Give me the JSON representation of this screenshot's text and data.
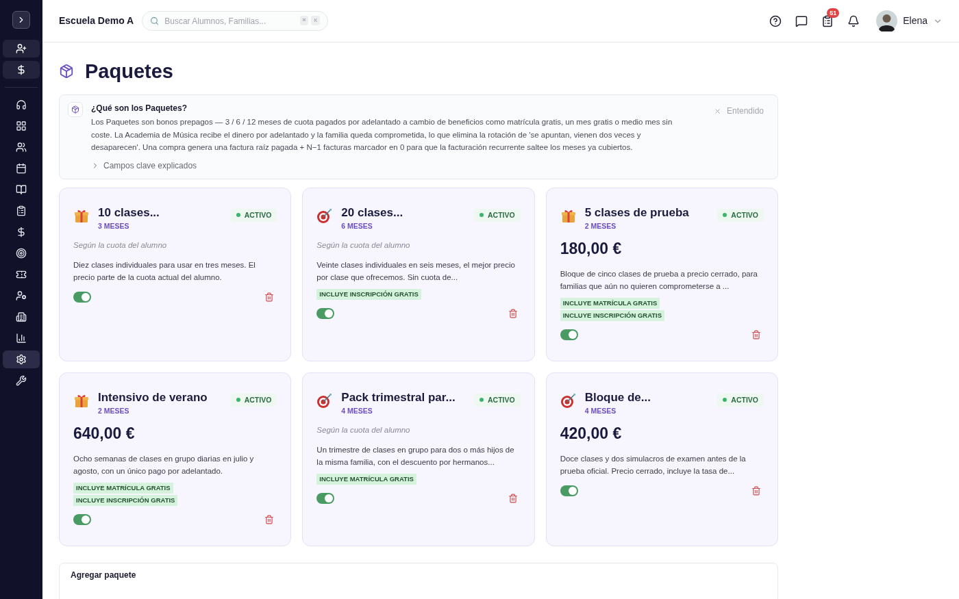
{
  "header": {
    "school": "Escuela Demo A",
    "search": {
      "placeholder": "Buscar Alumnos, Familias...",
      "keys": [
        "⌘",
        "K"
      ]
    },
    "tasks_badge": "51",
    "user": "Elena"
  },
  "sidebar": {
    "items": [
      {
        "selected": false
      },
      {
        "selected": false
      },
      {
        "selected": false
      },
      {
        "selected": false
      },
      {
        "selected": false
      },
      {
        "selected": false
      },
      {
        "selected": false
      },
      {
        "selected": false
      },
      {
        "selected": false
      },
      {
        "selected": false
      },
      {
        "selected": false
      },
      {
        "selected": false
      },
      {
        "selected": true
      },
      {
        "selected": false
      }
    ]
  },
  "page": {
    "title": "Paquetes"
  },
  "info": {
    "title": "¿Qué son los Paquetes?",
    "body": "Los Paquetes son bonos prepagos — 3 / 6 / 12 meses de cuota pagados por adelantado a cambio de beneficios como matrícula gratis, un mes gratis o medio mes sin coste. La Academia de Música recibe el dinero por adelantado y la familia queda comprometida, lo que elimina la rotación de 'se apuntan, vienen dos veces y desaparecen'. Una compra genera una factura raíz pagada + N−1 facturas marcador en 0 para que la facturación recurrente saltee los meses ya cubiertos.",
    "dismiss": "Entendido",
    "details": "Campos clave explicados",
    "expanded": false
  },
  "packages": [
    {
      "kind": "gift",
      "title": "10 clases...",
      "duration": "3 MESES",
      "status": "ACTIVO",
      "price_note": "Según la cuota del alumno",
      "description": "Diez clases individuales para usar en tres meses. El precio parte de la cuota actual del alumno.",
      "on": true
    },
    {
      "kind": "target",
      "title": "20 clases...",
      "duration": "6 MESES",
      "status": "ACTIVO",
      "price_note": "Según la cuota del alumno",
      "description": "Veinte clases individuales en seis meses, el mejor precio por clase que ofrecemos. Sin cuota de...",
      "tags": [
        "INCLUYE INSCRIPCIÓN GRATIS"
      ],
      "on": true
    },
    {
      "kind": "gift",
      "title": "5 clases de prueba",
      "duration": "2 MESES",
      "status": "ACTIVO",
      "price": "180,00 €",
      "description": "Bloque de cinco clases de prueba a precio cerrado, para familias que aún no quieren comprometerse a ...",
      "tags": [
        "INCLUYE MATRÍCULA GRATIS",
        "INCLUYE INSCRIPCIÓN GRATIS"
      ],
      "on": true
    },
    {
      "kind": "gift",
      "title": "Intensivo de verano",
      "duration": "2 MESES",
      "status": "ACTIVO",
      "price": "640,00 €",
      "description": "Ocho semanas de clases en grupo diarias en julio y agosto, con un único pago por adelantado.",
      "tags": [
        "INCLUYE MATRÍCULA GRATIS",
        "INCLUYE INSCRIPCIÓN GRATIS"
      ],
      "on": true
    },
    {
      "kind": "target",
      "title": "Pack trimestral par...",
      "duration": "4 MESES",
      "status": "ACTIVO",
      "price_note": "Según la cuota del alumno",
      "description": "Un trimestre de clases en grupo para dos o más hijos de la misma familia, con el descuento por hermanos...",
      "tags": [
        "INCLUYE MATRÍCULA GRATIS"
      ],
      "on": true
    },
    {
      "kind": "target",
      "title": "Bloque de...",
      "duration": "4 MESES",
      "status": "ACTIVO",
      "price": "420,00 €",
      "description": "Doce clases y dos simulacros de examen antes de la prueba oficial. Precio cerrado, incluye la tasa de...",
      "on": true
    }
  ],
  "add_section": {
    "title": "Agregar paquete"
  }
}
